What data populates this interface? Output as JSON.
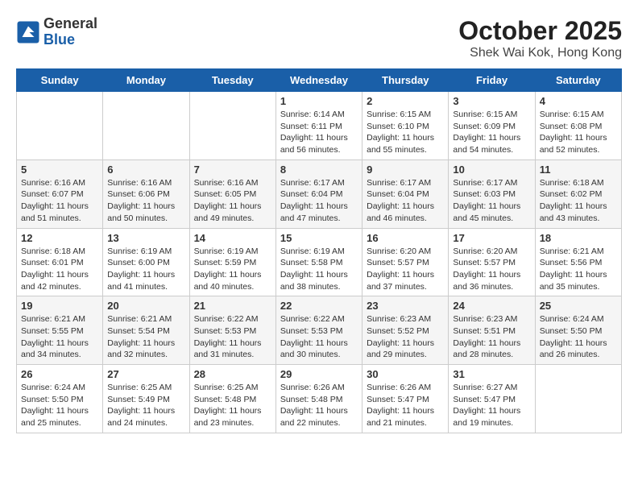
{
  "logo": {
    "general": "General",
    "blue": "Blue"
  },
  "title": "October 2025",
  "subtitle": "Shek Wai Kok, Hong Kong",
  "days": [
    "Sunday",
    "Monday",
    "Tuesday",
    "Wednesday",
    "Thursday",
    "Friday",
    "Saturday"
  ],
  "weeks": [
    [
      {
        "day": "",
        "info": ""
      },
      {
        "day": "",
        "info": ""
      },
      {
        "day": "",
        "info": ""
      },
      {
        "day": "1",
        "info": "Sunrise: 6:14 AM\nSunset: 6:11 PM\nDaylight: 11 hours and 56 minutes."
      },
      {
        "day": "2",
        "info": "Sunrise: 6:15 AM\nSunset: 6:10 PM\nDaylight: 11 hours and 55 minutes."
      },
      {
        "day": "3",
        "info": "Sunrise: 6:15 AM\nSunset: 6:09 PM\nDaylight: 11 hours and 54 minutes."
      },
      {
        "day": "4",
        "info": "Sunrise: 6:15 AM\nSunset: 6:08 PM\nDaylight: 11 hours and 52 minutes."
      }
    ],
    [
      {
        "day": "5",
        "info": "Sunrise: 6:16 AM\nSunset: 6:07 PM\nDaylight: 11 hours and 51 minutes."
      },
      {
        "day": "6",
        "info": "Sunrise: 6:16 AM\nSunset: 6:06 PM\nDaylight: 11 hours and 50 minutes."
      },
      {
        "day": "7",
        "info": "Sunrise: 6:16 AM\nSunset: 6:05 PM\nDaylight: 11 hours and 49 minutes."
      },
      {
        "day": "8",
        "info": "Sunrise: 6:17 AM\nSunset: 6:04 PM\nDaylight: 11 hours and 47 minutes."
      },
      {
        "day": "9",
        "info": "Sunrise: 6:17 AM\nSunset: 6:04 PM\nDaylight: 11 hours and 46 minutes."
      },
      {
        "day": "10",
        "info": "Sunrise: 6:17 AM\nSunset: 6:03 PM\nDaylight: 11 hours and 45 minutes."
      },
      {
        "day": "11",
        "info": "Sunrise: 6:18 AM\nSunset: 6:02 PM\nDaylight: 11 hours and 43 minutes."
      }
    ],
    [
      {
        "day": "12",
        "info": "Sunrise: 6:18 AM\nSunset: 6:01 PM\nDaylight: 11 hours and 42 minutes."
      },
      {
        "day": "13",
        "info": "Sunrise: 6:19 AM\nSunset: 6:00 PM\nDaylight: 11 hours and 41 minutes."
      },
      {
        "day": "14",
        "info": "Sunrise: 6:19 AM\nSunset: 5:59 PM\nDaylight: 11 hours and 40 minutes."
      },
      {
        "day": "15",
        "info": "Sunrise: 6:19 AM\nSunset: 5:58 PM\nDaylight: 11 hours and 38 minutes."
      },
      {
        "day": "16",
        "info": "Sunrise: 6:20 AM\nSunset: 5:57 PM\nDaylight: 11 hours and 37 minutes."
      },
      {
        "day": "17",
        "info": "Sunrise: 6:20 AM\nSunset: 5:57 PM\nDaylight: 11 hours and 36 minutes."
      },
      {
        "day": "18",
        "info": "Sunrise: 6:21 AM\nSunset: 5:56 PM\nDaylight: 11 hours and 35 minutes."
      }
    ],
    [
      {
        "day": "19",
        "info": "Sunrise: 6:21 AM\nSunset: 5:55 PM\nDaylight: 11 hours and 34 minutes."
      },
      {
        "day": "20",
        "info": "Sunrise: 6:21 AM\nSunset: 5:54 PM\nDaylight: 11 hours and 32 minutes."
      },
      {
        "day": "21",
        "info": "Sunrise: 6:22 AM\nSunset: 5:53 PM\nDaylight: 11 hours and 31 minutes."
      },
      {
        "day": "22",
        "info": "Sunrise: 6:22 AM\nSunset: 5:53 PM\nDaylight: 11 hours and 30 minutes."
      },
      {
        "day": "23",
        "info": "Sunrise: 6:23 AM\nSunset: 5:52 PM\nDaylight: 11 hours and 29 minutes."
      },
      {
        "day": "24",
        "info": "Sunrise: 6:23 AM\nSunset: 5:51 PM\nDaylight: 11 hours and 28 minutes."
      },
      {
        "day": "25",
        "info": "Sunrise: 6:24 AM\nSunset: 5:50 PM\nDaylight: 11 hours and 26 minutes."
      }
    ],
    [
      {
        "day": "26",
        "info": "Sunrise: 6:24 AM\nSunset: 5:50 PM\nDaylight: 11 hours and 25 minutes."
      },
      {
        "day": "27",
        "info": "Sunrise: 6:25 AM\nSunset: 5:49 PM\nDaylight: 11 hours and 24 minutes."
      },
      {
        "day": "28",
        "info": "Sunrise: 6:25 AM\nSunset: 5:48 PM\nDaylight: 11 hours and 23 minutes."
      },
      {
        "day": "29",
        "info": "Sunrise: 6:26 AM\nSunset: 5:48 PM\nDaylight: 11 hours and 22 minutes."
      },
      {
        "day": "30",
        "info": "Sunrise: 6:26 AM\nSunset: 5:47 PM\nDaylight: 11 hours and 21 minutes."
      },
      {
        "day": "31",
        "info": "Sunrise: 6:27 AM\nSunset: 5:47 PM\nDaylight: 11 hours and 19 minutes."
      },
      {
        "day": "",
        "info": ""
      }
    ]
  ]
}
